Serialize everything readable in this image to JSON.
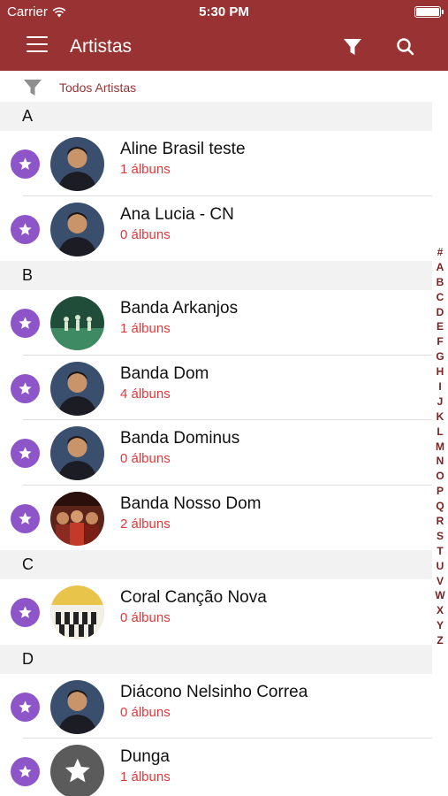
{
  "status_bar": {
    "carrier": "Carrier",
    "time": "5:30 PM"
  },
  "nav_bar": {
    "title": "Artistas"
  },
  "filter": {
    "label": "Todos Artistas"
  },
  "sections": [
    {
      "letter": "A",
      "artists": [
        {
          "name": "Aline Brasil teste",
          "albums": "1 álbuns",
          "avatar": "portrait"
        },
        {
          "name": "Ana Lucia - CN",
          "albums": "0 álbuns",
          "avatar": "portrait"
        }
      ]
    },
    {
      "letter": "B",
      "artists": [
        {
          "name": "Banda Arkanjos",
          "albums": "1 álbuns",
          "avatar": "stage"
        },
        {
          "name": "Banda Dom",
          "albums": "4 álbuns",
          "avatar": "portrait"
        },
        {
          "name": "Banda Dominus",
          "albums": "0 álbuns",
          "avatar": "portrait"
        },
        {
          "name": "Banda Nosso Dom",
          "albums": "2 álbuns",
          "avatar": "group"
        }
      ]
    },
    {
      "letter": "C",
      "artists": [
        {
          "name": "Coral Canção Nova",
          "albums": "0 álbuns",
          "avatar": "choir"
        }
      ]
    },
    {
      "letter": "D",
      "artists": [
        {
          "name": "Diácono Nelsinho Correa",
          "albums": "0 álbuns",
          "avatar": "portrait"
        },
        {
          "name": "Dunga",
          "albums": "1 álbuns",
          "avatar": "placeholder-star"
        }
      ]
    }
  ],
  "index_letters": [
    "#",
    "A",
    "B",
    "C",
    "D",
    "E",
    "F",
    "G",
    "H",
    "I",
    "J",
    "K",
    "L",
    "M",
    "N",
    "O",
    "P",
    "Q",
    "R",
    "S",
    "T",
    "U",
    "V",
    "W",
    "X",
    "Y",
    "Z"
  ],
  "colors": {
    "brand": "#993333",
    "album_count": "#e1383b",
    "favorite": "#8e55c9",
    "section_bg": "#f2f2f2"
  }
}
